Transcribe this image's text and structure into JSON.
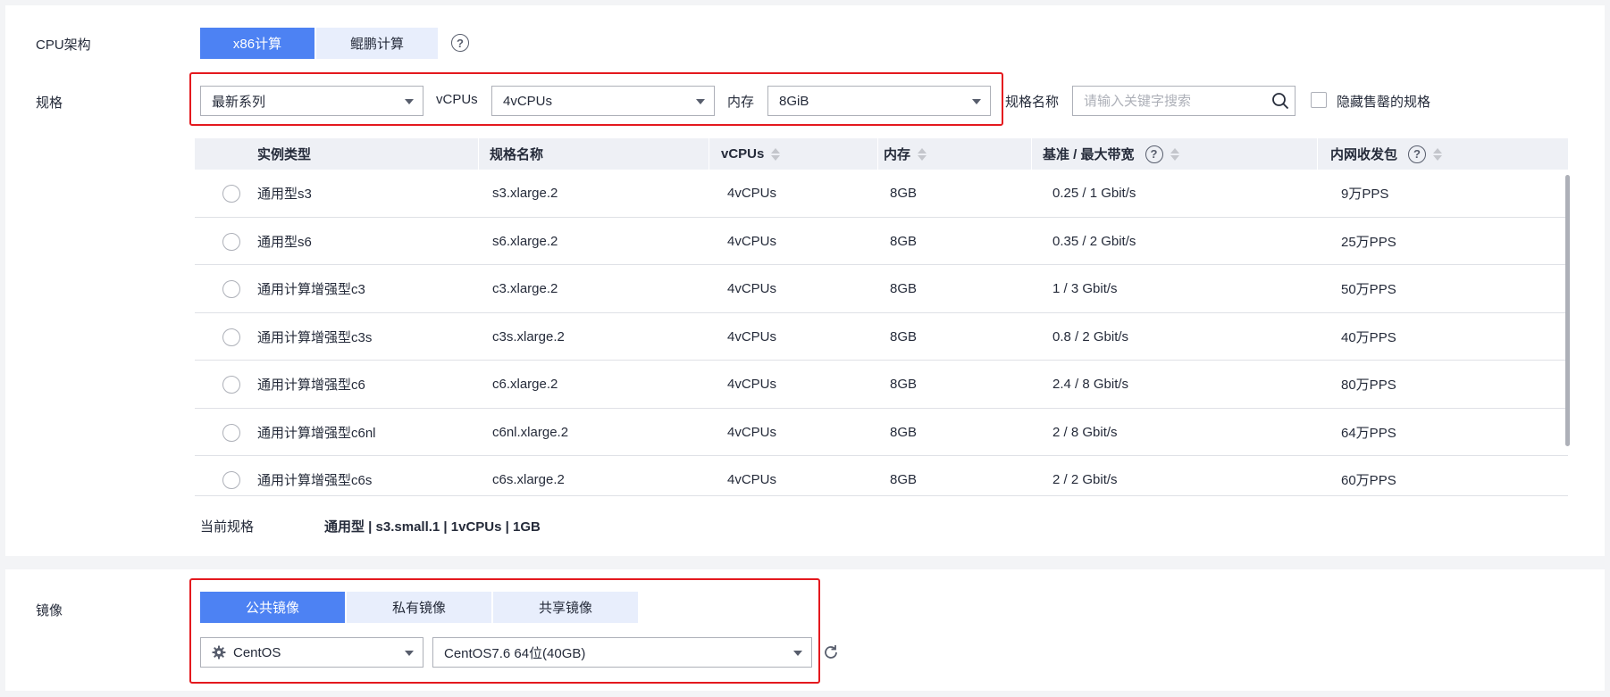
{
  "spec_section": {
    "cpu_arch_label": "CPU架构",
    "cpu_arch_tabs": [
      {
        "label": "x86计算",
        "active": true
      },
      {
        "label": "鲲鹏计算",
        "active": false
      }
    ],
    "help_glyph": "?",
    "spec_label": "规格",
    "series_select": "最新系列",
    "vcpus_label": "vCPUs",
    "vcpus_select": "4vCPUs",
    "memory_label": "内存",
    "memory_select": "8GiB",
    "spec_name_label": "规格名称",
    "search_placeholder": "请输入关键字搜索",
    "hide_soldout_label": "隐藏售罄的规格",
    "table": {
      "columns": [
        "实例类型",
        "规格名称",
        "vCPUs",
        "内存",
        "基准 / 最大带宽",
        "内网收发包"
      ],
      "rows": [
        {
          "type": "通用型s3",
          "name": "s3.xlarge.2",
          "vcpus": "4vCPUs",
          "mem": "8GB",
          "bw": "0.25 / 1 Gbit/s",
          "pps": "9万PPS"
        },
        {
          "type": "通用型s6",
          "name": "s6.xlarge.2",
          "vcpus": "4vCPUs",
          "mem": "8GB",
          "bw": "0.35 / 2 Gbit/s",
          "pps": "25万PPS"
        },
        {
          "type": "通用计算增强型c3",
          "name": "c3.xlarge.2",
          "vcpus": "4vCPUs",
          "mem": "8GB",
          "bw": "1 / 3 Gbit/s",
          "pps": "50万PPS"
        },
        {
          "type": "通用计算增强型c3s",
          "name": "c3s.xlarge.2",
          "vcpus": "4vCPUs",
          "mem": "8GB",
          "bw": "0.8 / 2 Gbit/s",
          "pps": "40万PPS"
        },
        {
          "type": "通用计算增强型c6",
          "name": "c6.xlarge.2",
          "vcpus": "4vCPUs",
          "mem": "8GB",
          "bw": "2.4 / 8 Gbit/s",
          "pps": "80万PPS"
        },
        {
          "type": "通用计算增强型c6nl",
          "name": "c6nl.xlarge.2",
          "vcpus": "4vCPUs",
          "mem": "8GB",
          "bw": "2 / 8 Gbit/s",
          "pps": "64万PPS"
        },
        {
          "type": "通用计算增强型c6s",
          "name": "c6s.xlarge.2",
          "vcpus": "4vCPUs",
          "mem": "8GB",
          "bw": "2 / 2 Gbit/s",
          "pps": "60万PPS"
        }
      ]
    },
    "current_spec_label": "当前规格",
    "current_spec_value": "通用型 | s3.small.1 | 1vCPUs | 1GB"
  },
  "image_section": {
    "label": "镜像",
    "tabs": [
      {
        "label": "公共镜像",
        "active": true
      },
      {
        "label": "私有镜像",
        "active": false
      },
      {
        "label": "共享镜像",
        "active": false
      }
    ],
    "os_select": "CentOS",
    "version_select": "CentOS7.6 64位(40GB)"
  },
  "colors": {
    "accent": "#4d82f3",
    "highlight_box": "#e4191e",
    "tab_inactive": "#e8eefc",
    "table_header": "#eef0f5"
  },
  "icons": [
    "help-icon",
    "caret-down-icon",
    "search-icon",
    "gear-icon",
    "refresh-icon",
    "sort-icon",
    "radio-icon",
    "checkbox-icon"
  ]
}
